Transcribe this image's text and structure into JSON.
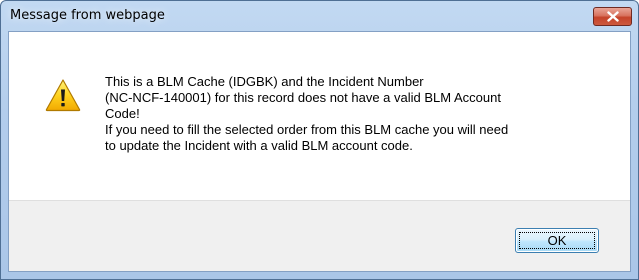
{
  "window": {
    "title": "Message from webpage",
    "close_icon": "close-icon"
  },
  "dialog": {
    "icon": "warning-icon",
    "icon_color": "#f5c400",
    "message_lines": [
      "This is a BLM Cache (IDGBK) and the Incident Number",
      "(NC-NCF-140001) for this record does not have a valid BLM Account",
      "Code!",
      "If you need to fill the selected order from this BLM cache you will need",
      "to update the Incident with a valid BLM account code."
    ]
  },
  "buttons": {
    "ok_label": "OK"
  }
}
